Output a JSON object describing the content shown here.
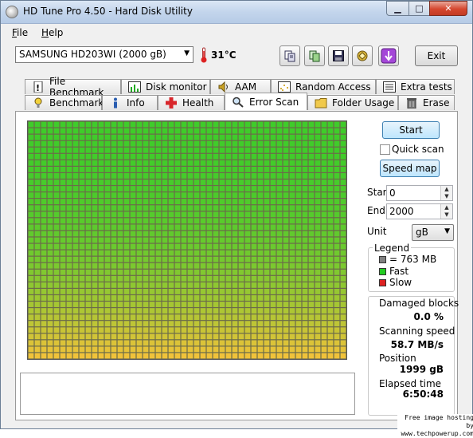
{
  "window": {
    "title": "HD Tune Pro 4.50 - Hard Disk Utility"
  },
  "menu": {
    "file_prefix": "F",
    "file_rest": "ile",
    "help_prefix": "H",
    "help_rest": "elp"
  },
  "toolbar": {
    "drive": "SAMSUNG HD203WI (2000 gB)",
    "temperature": "31°C",
    "exit_label": "Exit",
    "icons": [
      "copy-icon",
      "copy-all-icon",
      "save-icon",
      "screenshot-icon",
      "options-icon"
    ]
  },
  "tabs": {
    "row1": [
      "File Benchmark",
      "Disk monitor",
      "AAM",
      "Random Access",
      "Extra tests"
    ],
    "row2": [
      "Benchmark",
      "Info",
      "Health",
      "Error Scan",
      "Folder Usage",
      "Erase"
    ],
    "active": "Error Scan"
  },
  "scan": {
    "start_label": "Start",
    "quick_scan_label": "Quick scan",
    "quick_scan_checked": false,
    "speed_map_label": "Speed map",
    "start_field_label": "Start",
    "start_value": "0",
    "end_field_label": "End",
    "end_value": "2000",
    "unit_label": "Unit",
    "unit_value": "gB"
  },
  "legend": {
    "title": "Legend",
    "block_size": "= 763 MB",
    "fast": "Fast",
    "slow": "Slow",
    "colors": {
      "block": "#808080",
      "fast": "#22cc22",
      "slow": "#dd2222"
    }
  },
  "stats": {
    "damaged_label": "Damaged blocks",
    "damaged_value": "0.0 %",
    "speed_label": "Scanning speed",
    "speed_value": "58.7 MB/s",
    "position_label": "Position",
    "position_value": "1999 gB",
    "elapsed_label": "Elapsed time",
    "elapsed_value": "6:50:48"
  },
  "block_map": {
    "columns": 50,
    "rows": 37,
    "damaged_blocks": 0,
    "color_top": "#3fcc2a",
    "color_bottom": "#f0c23a"
  },
  "watermark": {
    "line1": "Free image hosting by",
    "line2": "www.techpowerup.com"
  }
}
